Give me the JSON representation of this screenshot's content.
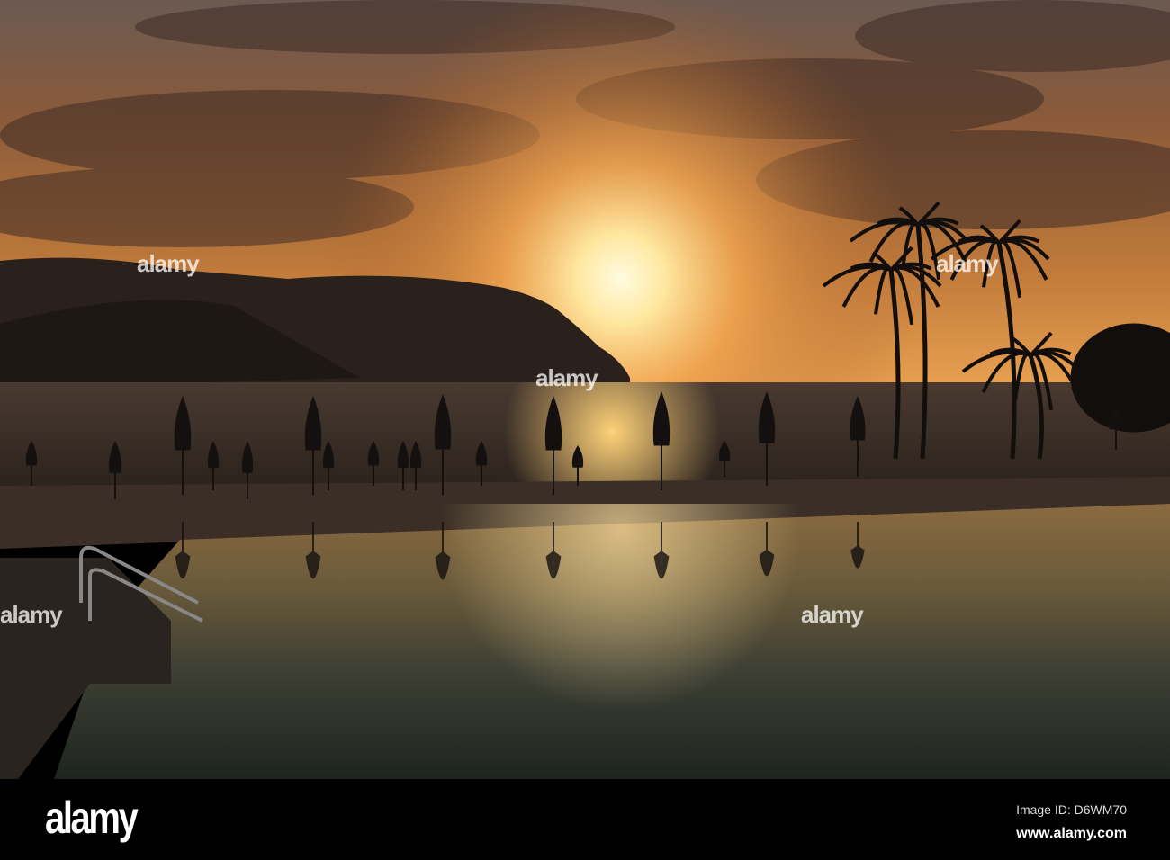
{
  "image": {
    "subject": "Sunset over ocean and mountains with palm trees and closed umbrellas reflected in resort pool"
  },
  "watermark": {
    "text": "alamy"
  },
  "footer": {
    "logo": "alamy",
    "image_id": "Image ID: D6WM70",
    "url": "www.alamy.com"
  }
}
